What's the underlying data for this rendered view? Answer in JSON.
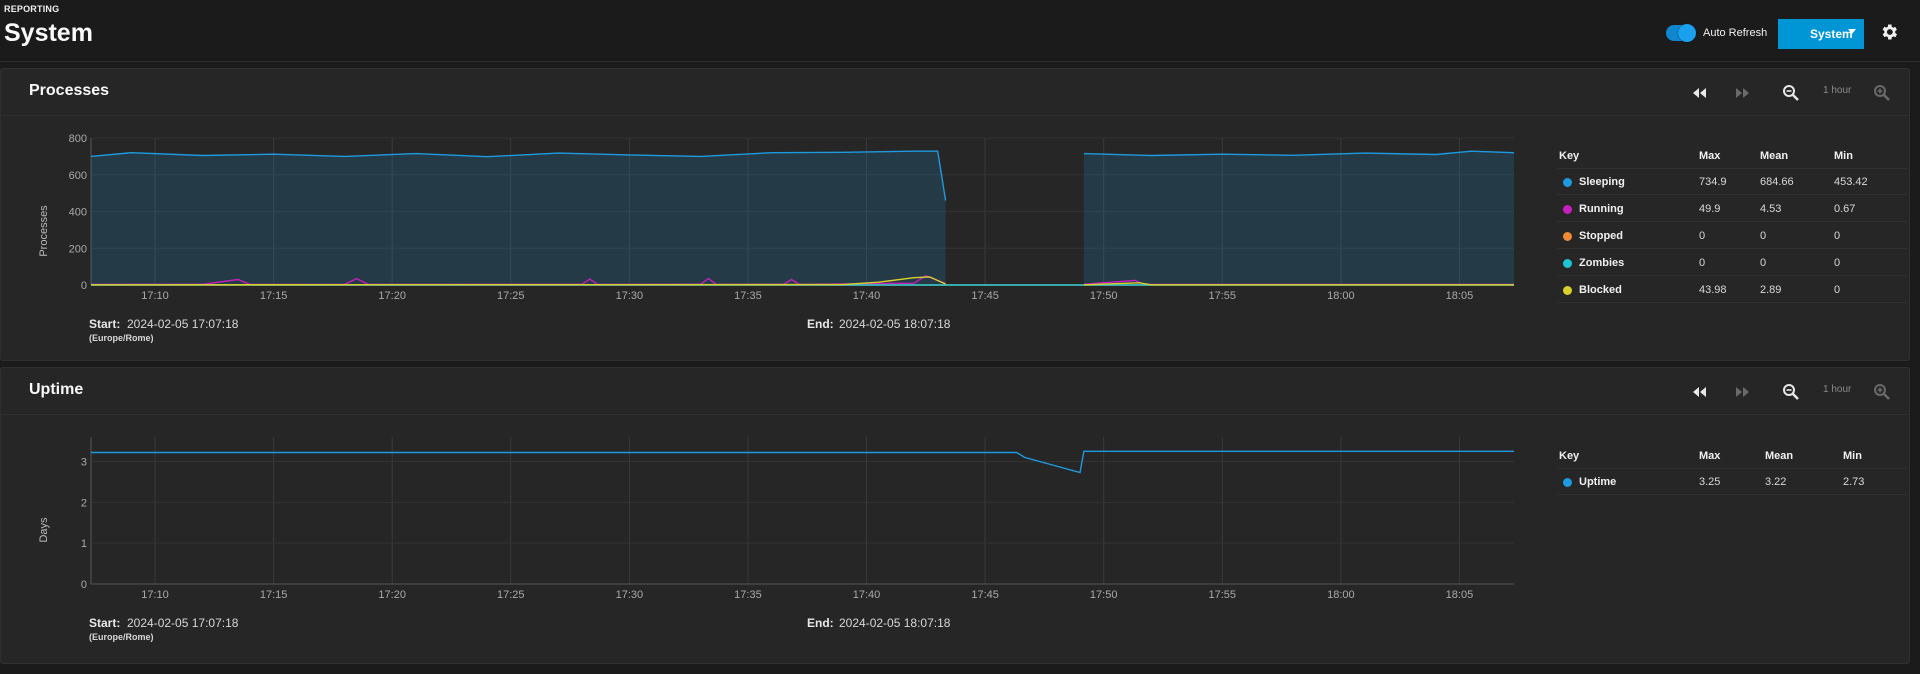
{
  "header": {
    "eyebrow": "REPORTING",
    "title": "System",
    "auto_refresh_label": "Auto Refresh",
    "auto_refresh_on": true,
    "system_button_label": "System"
  },
  "colors": {
    "accent": "#0095d5",
    "sleeping": "#1e9ae0",
    "running": "#c71fbd",
    "stopped": "#f08a36",
    "zombies": "#1ec6d4",
    "blocked": "#d9d02e"
  },
  "icons": [
    "rewind-icon",
    "fast-forward-icon",
    "zoom-out-icon",
    "zoom-in-icon",
    "gear-icon",
    "chevron-down-icon"
  ],
  "cards": [
    {
      "title": "Processes",
      "range_label": "1 hour",
      "y_axis_label": "Processes",
      "start_label": "Start:",
      "start_value": "2024-02-05 17:07:18",
      "timezone": "(Europe/Rome)",
      "end_label": "End:",
      "end_value": "2024-02-05 18:07:18",
      "legend": {
        "headers": [
          "Key",
          "Max",
          "Mean",
          "Min"
        ],
        "rows": [
          {
            "name": "Sleeping",
            "max": "734.9",
            "mean": "684.66",
            "min": "453.42"
          },
          {
            "name": "Running",
            "max": "49.9",
            "mean": "4.53",
            "min": "0.67"
          },
          {
            "name": "Stopped",
            "max": "0",
            "mean": "0",
            "min": "0"
          },
          {
            "name": "Zombies",
            "max": "0",
            "mean": "0",
            "min": "0"
          },
          {
            "name": "Blocked",
            "max": "43.98",
            "mean": "2.89",
            "min": "0"
          }
        ]
      }
    },
    {
      "title": "Uptime",
      "range_label": "1 hour",
      "y_axis_label": "Days",
      "start_label": "Start:",
      "start_value": "2024-02-05 17:07:18",
      "timezone": "(Europe/Rome)",
      "end_label": "End:",
      "end_value": "2024-02-05 18:07:18",
      "legend": {
        "headers": [
          "Key",
          "Max",
          "Mean",
          "Min"
        ],
        "rows": [
          {
            "name": "Uptime",
            "max": "3.25",
            "mean": "3.22",
            "min": "2.73"
          }
        ]
      }
    }
  ],
  "chart_data": [
    {
      "type": "area",
      "title": "Processes",
      "ylabel": "Processes",
      "ylim": [
        0,
        800
      ],
      "yticks": [
        0,
        200,
        400,
        600,
        800
      ],
      "xlim": [
        "17:07:18",
        "18:07:18"
      ],
      "xticks": [
        "17:10",
        "17:15",
        "17:20",
        "17:25",
        "17:30",
        "17:35",
        "17:40",
        "17:45",
        "17:50",
        "17:55",
        "18:00",
        "18:05"
      ],
      "grid": true,
      "legend_position": "right",
      "gaps": [
        [
          "17:43:20",
          "17:49:10"
        ]
      ],
      "series": [
        {
          "name": "Sleeping",
          "points": [
            [
              "17:07:18",
              700
            ],
            [
              "17:09:00",
              720
            ],
            [
              "17:12:00",
              705
            ],
            [
              "17:15:00",
              712
            ],
            [
              "17:18:00",
              700
            ],
            [
              "17:21:00",
              715
            ],
            [
              "17:24:00",
              698
            ],
            [
              "17:27:00",
              718
            ],
            [
              "17:30:00",
              708
            ],
            [
              "17:33:00",
              700
            ],
            [
              "17:36:00",
              720
            ],
            [
              "17:39:00",
              722
            ],
            [
              "17:42:00",
              728
            ],
            [
              "17:43:00",
              728
            ],
            [
              "17:43:20",
              460
            ],
            [
              "17:49:10",
              715
            ],
            [
              "17:52:00",
              705
            ],
            [
              "17:55:00",
              712
            ],
            [
              "17:58:00",
              706
            ],
            [
              "18:01:00",
              718
            ],
            [
              "18:04:00",
              710
            ],
            [
              "18:05:30",
              728
            ],
            [
              "18:07:18",
              720
            ]
          ]
        },
        {
          "name": "Running",
          "points": [
            [
              "17:07:18",
              3
            ],
            [
              "17:12:00",
              4
            ],
            [
              "17:13:30",
              30
            ],
            [
              "17:14:00",
              3
            ],
            [
              "17:18:00",
              4
            ],
            [
              "17:18:30",
              35
            ],
            [
              "17:19:00",
              3
            ],
            [
              "17:28:00",
              4
            ],
            [
              "17:28:20",
              32
            ],
            [
              "17:28:40",
              3
            ],
            [
              "17:33:00",
              4
            ],
            [
              "17:33:20",
              35
            ],
            [
              "17:33:40",
              3
            ],
            [
              "17:36:30",
              4
            ],
            [
              "17:36:50",
              30
            ],
            [
              "17:37:10",
              3
            ],
            [
              "17:42:00",
              10
            ],
            [
              "17:42:30",
              49.9
            ],
            [
              "17:43:20",
              8
            ],
            [
              "17:49:10",
              4
            ],
            [
              "17:51:20",
              25
            ],
            [
              "17:51:40",
              3
            ],
            [
              "18:07:18",
              3
            ]
          ]
        },
        {
          "name": "Stopped",
          "points": [
            [
              "17:07:18",
              0
            ],
            [
              "18:07:18",
              0
            ]
          ]
        },
        {
          "name": "Zombies",
          "points": [
            [
              "17:07:18",
              0
            ],
            [
              "18:07:18",
              0
            ]
          ]
        },
        {
          "name": "Blocked",
          "points": [
            [
              "17:07:18",
              1
            ],
            [
              "17:39:00",
              2
            ],
            [
              "17:40:30",
              15
            ],
            [
              "17:42:00",
              40
            ],
            [
              "17:42:40",
              43.98
            ],
            [
              "17:43:20",
              5
            ],
            [
              "17:49:10",
              1
            ],
            [
              "17:51:30",
              12
            ],
            [
              "17:52:00",
              1
            ],
            [
              "18:07:18",
              1
            ]
          ]
        }
      ]
    },
    {
      "type": "line",
      "title": "Uptime",
      "ylabel": "Days",
      "ylim": [
        0,
        3.6
      ],
      "yticks": [
        0,
        1,
        2,
        3
      ],
      "xlim": [
        "17:07:18",
        "18:07:18"
      ],
      "xticks": [
        "17:10",
        "17:15",
        "17:20",
        "17:25",
        "17:30",
        "17:35",
        "17:40",
        "17:45",
        "17:50",
        "17:55",
        "18:00",
        "18:05"
      ],
      "grid": true,
      "legend_position": "right",
      "gaps": [
        [
          "17:46:40",
          "17:49:00"
        ]
      ],
      "series": [
        {
          "name": "Uptime",
          "points": [
            [
              "17:07:18",
              3.22
            ],
            [
              "17:46:20",
              3.22
            ],
            [
              "17:46:40",
              3.1
            ],
            [
              "17:49:00",
              2.73
            ],
            [
              "17:49:10",
              3.25
            ],
            [
              "18:07:18",
              3.25
            ]
          ]
        }
      ]
    }
  ]
}
